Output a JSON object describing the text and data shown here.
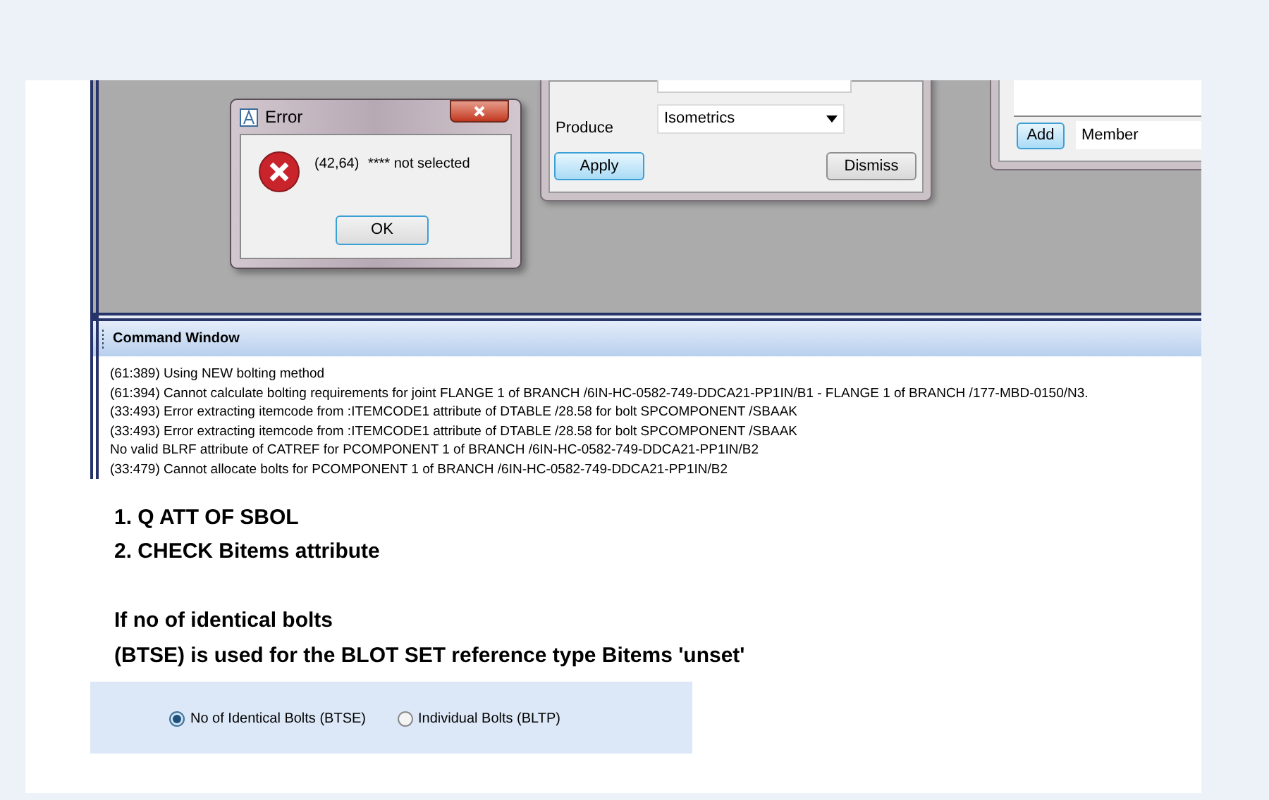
{
  "error_dialog": {
    "title": "Error",
    "code": "(42,64)",
    "message": "**** not selected",
    "button": "OK"
  },
  "isometrics_panel": {
    "field_label": "Produce",
    "field_value": "Isometrics",
    "buttons": [
      {
        "label": "Apply",
        "default": true
      },
      {
        "label": "Dismiss",
        "default": false
      }
    ]
  },
  "member_panel": {
    "button": {
      "label": "Add",
      "default": true
    },
    "value": "Member"
  },
  "command_window": {
    "title": "Command Window",
    "lines": [
      "(61:389) Using NEW bolting method",
      "(61:394) Cannot calculate bolting requirements for joint FLANGE 1 of BRANCH /6IN-HC-0582-749-DDCA21-PP1IN/B1 - FLANGE 1 of BRANCH /177-MBD-0150/N3.",
      "(33:493) Error extracting itemcode from :ITEMCODE1 attribute of DTABLE /28.58 for bolt SPCOMPONENT /SBAAK",
      "(33:493) Error extracting itemcode from :ITEMCODE1 attribute of DTABLE /28.58 for bolt SPCOMPONENT /SBAAK",
      "No valid BLRF attribute of CATREF for PCOMPONENT 1 of BRANCH /6IN-HC-0582-749-DDCA21-PP1IN/B2",
      "(33:479) Cannot allocate bolts for PCOMPONENT 1 of BRANCH /6IN-HC-0582-749-DDCA21-PP1IN/B2"
    ]
  },
  "notes": {
    "steps": [
      "1. Q ATT OF SBOL",
      "2. CHECK Bitems attribute"
    ],
    "paragraph": [
      "If no of identical bolts",
      "(BTSE) is used for the BLOT SET reference type Bitems 'unset'"
    ]
  },
  "bolt_options": [
    {
      "label": "No of Identical Bolts (BTSE)",
      "selected": true
    },
    {
      "label": "Individual Bolts (BLTP)",
      "selected": false
    }
  ]
}
